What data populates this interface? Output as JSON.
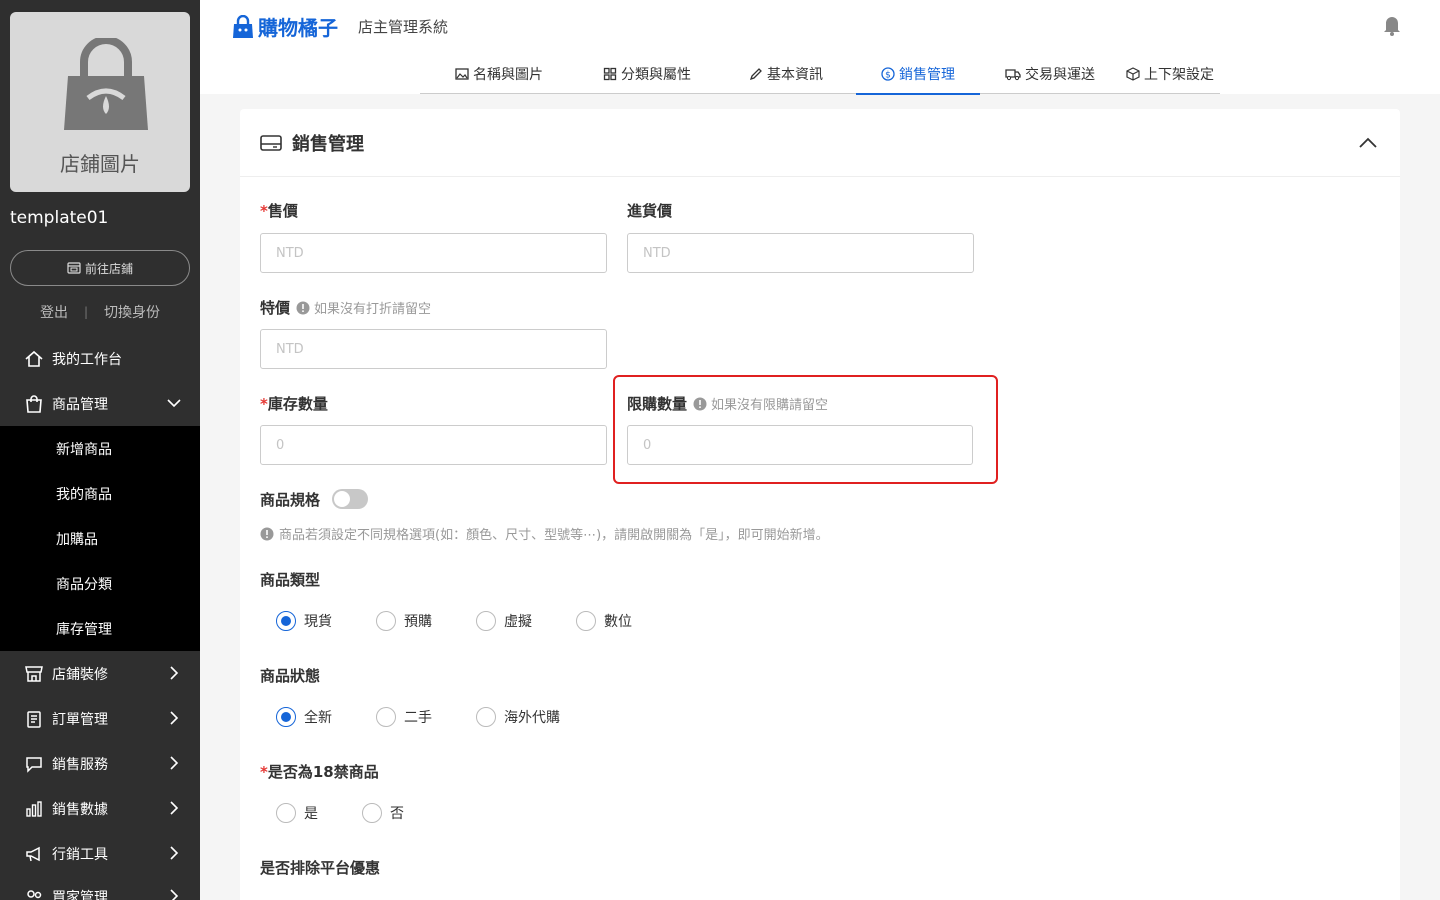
{
  "sidebar": {
    "store_image_label": "店鋪圖片",
    "store_name": "template01",
    "goto_store": "前往店鋪",
    "logout": "登出",
    "separator": "|",
    "switch_identity": "切換身份",
    "nav": [
      {
        "label": "我的工作台",
        "icon": "home-icon"
      },
      {
        "label": "商品管理",
        "icon": "bag-icon",
        "expanded": true
      },
      {
        "label": "店鋪裝修",
        "icon": "store-icon"
      },
      {
        "label": "訂單管理",
        "icon": "clipboard-icon"
      },
      {
        "label": "銷售服務",
        "icon": "chat-icon"
      },
      {
        "label": "銷售數據",
        "icon": "bar-chart-icon"
      },
      {
        "label": "行銷工具",
        "icon": "megaphone-icon"
      },
      {
        "label": "買家管理",
        "icon": "users-icon"
      }
    ],
    "sub_items": [
      "新增商品",
      "我的商品",
      "加購品",
      "商品分類",
      "庫存管理"
    ]
  },
  "header": {
    "brand": "購物橘子",
    "subtitle": "店主管理系統",
    "tabs": [
      {
        "label": "名稱與圖片",
        "icon": "image-icon"
      },
      {
        "label": "分類與屬性",
        "icon": "grid-icon"
      },
      {
        "label": "基本資訊",
        "icon": "pencil-icon"
      },
      {
        "label": "銷售管理",
        "icon": "dollar-icon",
        "active": true
      },
      {
        "label": "交易與運送",
        "icon": "truck-icon"
      },
      {
        "label": "上下架設定",
        "icon": "box-icon"
      }
    ]
  },
  "section": {
    "title": "銷售管理",
    "price_label": "售價",
    "price_placeholder": "NTD",
    "cost_label": "進貨價",
    "cost_placeholder": "NTD",
    "special_label": "特價",
    "special_hint": "如果沒有打折請留空",
    "special_placeholder": "NTD",
    "stock_label": "庫存數量",
    "stock_placeholder": "0",
    "limit_label": "限購數量",
    "limit_hint": "如果沒有限購請留空",
    "limit_placeholder": "0",
    "spec_label": "商品規格",
    "spec_note": "商品若須設定不同規格選項(如：顏色、尺寸、型號等⋯)，請開啟開關為「是」，即可開始新增。",
    "type_label": "商品類型",
    "type_options": [
      "現貨",
      "預購",
      "虛擬",
      "數位"
    ],
    "status_label": "商品狀態",
    "status_options": [
      "全新",
      "二手",
      "海外代購"
    ],
    "adult_label": "是否為18禁商品",
    "adult_options": [
      "是",
      "否"
    ],
    "exclude_label": "是否排除平台優惠",
    "required_mark": "*"
  },
  "colors": {
    "accent": "#1565d8",
    "sidebar": "#2f2f2f",
    "highlight": "#e02020"
  }
}
